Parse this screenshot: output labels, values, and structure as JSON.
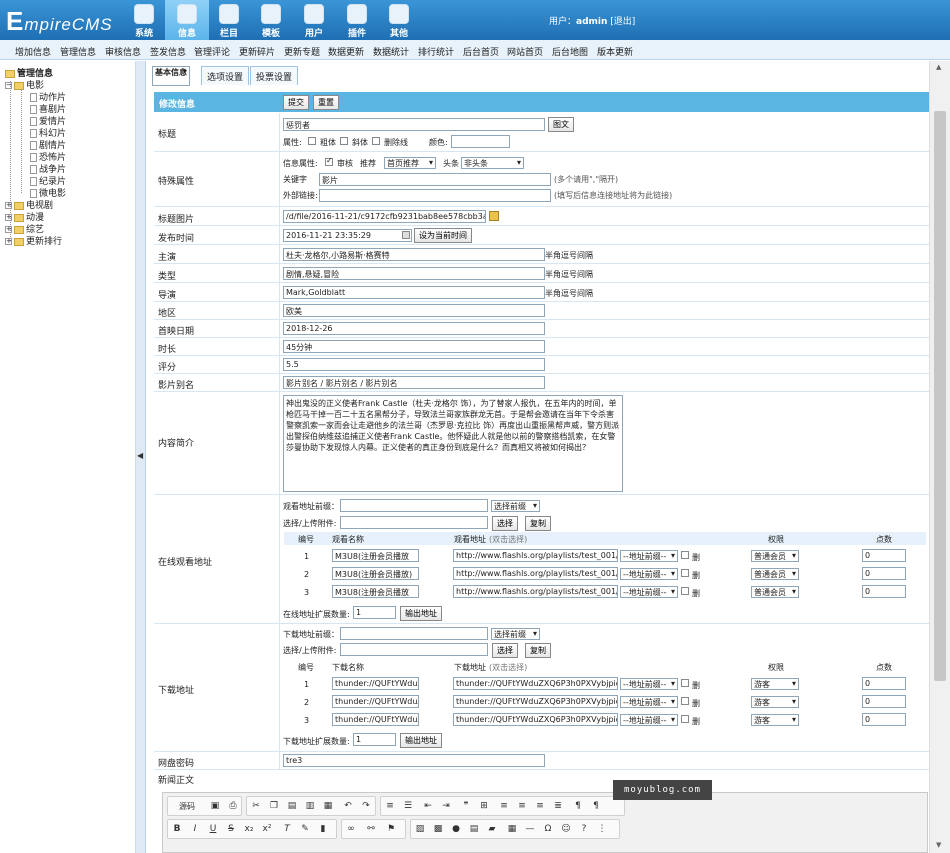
{
  "logo": {
    "prefix": "E",
    "rest": "mpireCMS"
  },
  "topnav": [
    "系统",
    "信息",
    "栏目",
    "模板",
    "用户",
    "插件",
    "其他"
  ],
  "user": {
    "label": "用户：",
    "name": "admin",
    "logout": "[退出]"
  },
  "menu": [
    "增加信息",
    "管理信息",
    "审核信息",
    "签发信息",
    "管理评论",
    "更新碎片",
    "更新专题",
    "数据更新",
    "数据统计",
    "排行统计",
    "后台首页",
    "网站首页",
    "后台地图",
    "版本更新"
  ],
  "sidebar": {
    "root": "管理信息",
    "movie": "电影",
    "movie_children": [
      "动作片",
      "喜剧片",
      "爱情片",
      "科幻片",
      "剧情片",
      "恐怖片",
      "战争片",
      "纪录片",
      "微电影"
    ],
    "others": [
      "电视剧",
      "动漫",
      "综艺",
      "更新排行"
    ]
  },
  "tabs": [
    "基本信息",
    "选项设置",
    "投票设置"
  ],
  "form": {
    "header": "修改信息",
    "submit": "提交",
    "reset": "重置",
    "title": {
      "label": "标题",
      "value": "惩罚者",
      "font_btn": "图文",
      "attr": "属性:",
      "bold": "粗体",
      "italic": "斜体",
      "strike": "删除线",
      "color": "颜色:"
    },
    "special": {
      "label": "特殊属性",
      "info_attr": "信息属性:",
      "audit": "审核",
      "recommend": "推荐",
      "rec_val": "首页推荐",
      "headline": "头条",
      "head_val": "非头条",
      "keyword": "关键字",
      "keyword_val": "影片",
      "keyword_note": "(多个请用\",\"隔开)",
      "extlink": "外部链接:",
      "extlink_note": "(填写后信息连接地址将为此链接)"
    },
    "titlepic": {
      "label": "标题图片",
      "value": "/d/file/2016-11-21/c9172cfb9231bab8ee578cbb3a51"
    },
    "pubtime": {
      "label": "发布时间",
      "value": "2016-11-21 23:35:29",
      "btn": "设为当前时间"
    },
    "actor": {
      "label": "主演",
      "value": "杜夫·龙格尔,小路易斯·格赛特",
      "note": "半角逗号间隔"
    },
    "type": {
      "label": "类型",
      "value": "剧情,悬疑,冒险",
      "note": "半角逗号间隔"
    },
    "director": {
      "label": "导演",
      "value": "Mark,Goldblatt",
      "note": "半角逗号间隔"
    },
    "region": {
      "label": "地区",
      "value": "欧美"
    },
    "premiere": {
      "label": "首映日期",
      "value": "2018-12-26"
    },
    "duration": {
      "label": "时长",
      "value": "45分钟"
    },
    "score": {
      "label": "评分",
      "value": "5.5"
    },
    "alias": {
      "label": "影片别名",
      "value": "影片别名 / 影片别名 / 影片别名"
    },
    "intro": {
      "label": "内容简介",
      "value": "神出鬼没的正义使者Frank Castle（杜夫·龙格尔 饰），为了替家人报仇，在五年内的时间，单枪匹马干掉一百二十五名黑帮分子，导致法兰哥家族群龙无首。于是帮会邀请在当年下令杀害警察凯索一家而会让走避他乡的法兰哥（杰罗恩·克拉比 饰）再度出山重振黑帮声威，警方则派出警探伯纳维兹追捕正义使者Frank Castle。他怀疑此人就是他以前的警察搭档凯索，在女警莎曼协助下发现惊人内幕。正义使者的真正身份到底是什么？而真相又将被如何揭出？"
    },
    "online": {
      "label": "在线观看地址",
      "prefix_label": "观看地址前缀：",
      "prefix_sel": "选择前缀",
      "upload_label": "选择/上传附件:",
      "choose": "选择",
      "copy": "复制",
      "cols": [
        "编号",
        "观看名称",
        "观看地址",
        "(双击选择)",
        "权限",
        "点数"
      ],
      "rows": [
        {
          "no": "1",
          "name": "M3U8(注册会员播放",
          "url": "http://www.flashls.org/playlists/test_001/str",
          "pre": "--地址前缀--",
          "del": "删",
          "perm": "普通会员",
          "pts": "0"
        },
        {
          "no": "2",
          "name": "M3U8(注册会员播放)",
          "url": "http://www.flashls.org/playlists/test_001/str",
          "pre": "--地址前缀--",
          "del": "删",
          "perm": "普通会员",
          "pts": "0"
        },
        {
          "no": "3",
          "name": "M3U8(注册会员播放",
          "url": "http://www.flashls.org/playlists/test_001/str",
          "pre": "--地址前缀--",
          "del": "删",
          "perm": "普通会员",
          "pts": "0"
        }
      ],
      "ext_label": "在线地址扩展数量:",
      "ext_val": "1",
      "ext_btn": "输出地址"
    },
    "download": {
      "label": "下载地址",
      "prefix_label": "下载地址前缀：",
      "prefix_sel": "选择前缀",
      "upload_label": "选择/上传附件:",
      "choose": "选择",
      "copy": "复制",
      "cols": [
        "编号",
        "下载名称",
        "下载地址",
        "(双击选择)",
        "权限",
        "点数"
      ],
      "rows": [
        {
          "no": "1",
          "name": "thunder://QUFtYWduZX",
          "url": "thunder://QUFtYWduZXQ6P3h0PXVybjpidGl",
          "pre": "--地址前缀--",
          "del": "删",
          "perm": "游客",
          "pts": "0"
        },
        {
          "no": "2",
          "name": "thunder://QUFtYWduZX",
          "url": "thunder://QUFtYWduZXQ6P3h0PXVybjpidGl",
          "pre": "--地址前缀--",
          "del": "删",
          "perm": "游客",
          "pts": "0"
        },
        {
          "no": "3",
          "name": "thunder://QUFtYWduZX",
          "url": "thunder://QUFtYWduZXQ6P3h0PXVybjpidGl",
          "pre": "--地址前缀--",
          "del": "删",
          "perm": "游客",
          "pts": "0"
        }
      ],
      "ext_label": "下载地址扩展数量:",
      "ext_val": "1",
      "ext_btn": "输出地址"
    },
    "pan": {
      "label": "网盘密码",
      "value": "tre3"
    },
    "body": {
      "label": "新闻正文",
      "source_btn": "源码"
    }
  },
  "watermark": "moyublog.com"
}
